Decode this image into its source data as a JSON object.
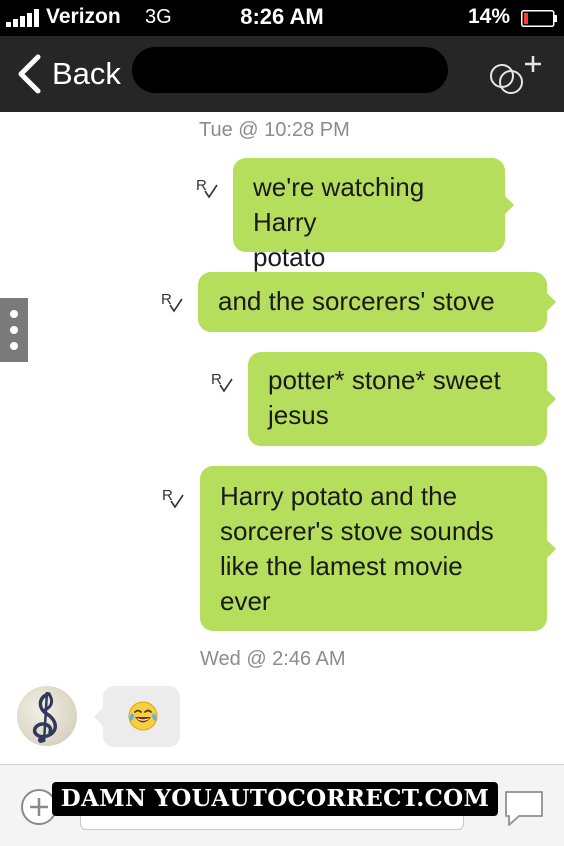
{
  "status_bar": {
    "carrier": "Verizon",
    "network": "3G",
    "time": "8:26 AM",
    "battery_percent": "14%",
    "battery_level": 0.14,
    "battery_color": "#ff3b30"
  },
  "nav": {
    "back_label": "Back",
    "back_icon": "chevron-left-icon",
    "add_icon": "add-participant-icon"
  },
  "conversation": {
    "timestamps": [
      "Tue @ 10:28 PM",
      "Wed @ 2:46 AM"
    ],
    "outgoing_messages": [
      {
        "lines": [
          "we're watching Harry",
          "potato"
        ],
        "status_icon": "read-receipt-icon"
      },
      {
        "lines": [
          "and the sorcerers' stove"
        ],
        "status_icon": "read-receipt-icon"
      },
      {
        "lines": [
          "potter* stone* sweet",
          "jesus"
        ],
        "status_icon": "read-receipt-icon"
      },
      {
        "lines": [
          "Harry potato and the",
          "sorcerer's stove sounds",
          "like the lamest movie",
          "ever"
        ],
        "status_icon": "read-receipt-icon"
      }
    ],
    "incoming_message": {
      "emoji": "face-with-tears-of-joy",
      "avatar_icon": "treble-clef-avatar-icon"
    },
    "outgoing_bubble_color": "#b4de5c",
    "incoming_bubble_color": "#ececec"
  },
  "input_bar": {
    "attach_icon": "plus-circle-icon",
    "send_icon": "chat-bubble-icon"
  },
  "watermark": "DAMN YOUAUTOCORRECT.COM"
}
